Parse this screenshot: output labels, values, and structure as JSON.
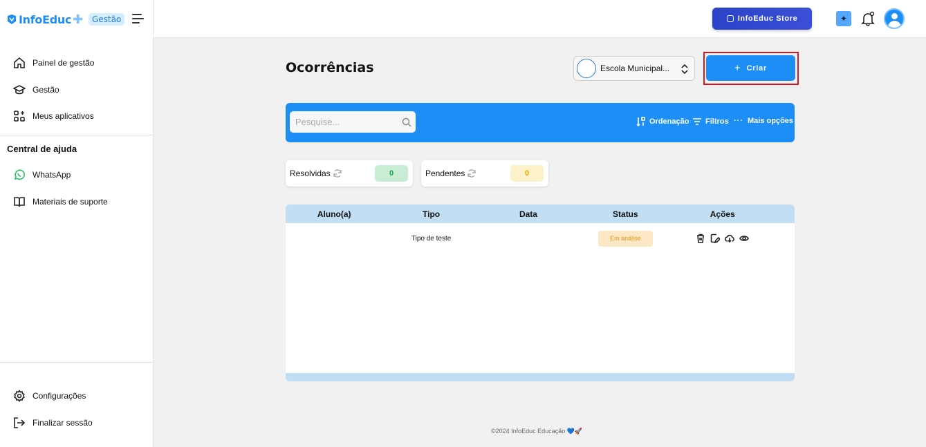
{
  "brand": {
    "name": "InfoEduc",
    "plus": "✚",
    "module_badge": "Gestão"
  },
  "sidebar": {
    "items": [
      {
        "label": "Painel de gestão",
        "icon": "home-icon"
      },
      {
        "label": "Gestão",
        "icon": "graduation-cap-icon"
      },
      {
        "label": "Meus aplicativos",
        "icon": "apps-icon"
      }
    ],
    "help_title": "Central de ajuda",
    "help_items": [
      {
        "label": "WhatsApp",
        "icon": "whatsapp-icon"
      },
      {
        "label": "Materiais de suporte",
        "icon": "book-icon"
      }
    ],
    "bottom_items": [
      {
        "label": "Configurações",
        "icon": "gear-icon"
      },
      {
        "label": "Finalizar sessão",
        "icon": "logout-icon"
      }
    ]
  },
  "header": {
    "store_label": "InfoEduc Store"
  },
  "page": {
    "title": "Ocorrências",
    "school_select": "Escola Municipal...",
    "create_label": "Criar"
  },
  "toolbar": {
    "search_placeholder": "Pesquise...",
    "sort_label": "Ordenação",
    "filter_label": "Filtros",
    "more_label": "Mais opções"
  },
  "stats": [
    {
      "label": "Resolvidas",
      "value": "0",
      "color": "#1aa14a"
    },
    {
      "label": "Pendentes",
      "value": "0",
      "color": "#f0a400"
    }
  ],
  "table": {
    "columns": [
      "Aluno(a)",
      "Tipo",
      "Data",
      "Status",
      "Ações"
    ],
    "rows": [
      {
        "aluno": "",
        "tipo": "Tipo de teste",
        "data": "",
        "status": "Em análise"
      }
    ]
  },
  "footer": {
    "text": "©2024 InfoEduc Educação 💙🚀"
  },
  "colors": {
    "primary": "#1e8ef7",
    "store": "#2a43c9",
    "highlight": "#e0141c"
  }
}
